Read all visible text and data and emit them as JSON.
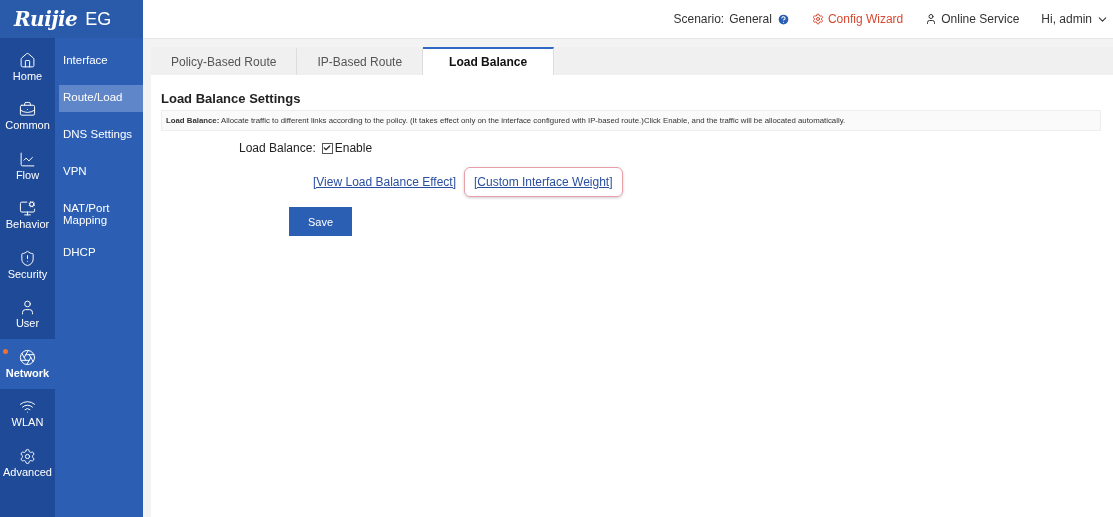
{
  "logo": {
    "brand": "Ruijie",
    "product": "EG"
  },
  "header": {
    "scenario_label": "Scenario:",
    "scenario_value": "General",
    "config_wizard": "Config Wizard",
    "online_service": "Online Service",
    "user_menu": "Hi, admin"
  },
  "nav": [
    {
      "label": "Home",
      "selected": false,
      "alert": false
    },
    {
      "label": "Common",
      "selected": false,
      "alert": false
    },
    {
      "label": "Flow",
      "selected": false,
      "alert": false
    },
    {
      "label": "Behavior",
      "selected": false,
      "alert": false
    },
    {
      "label": "Security",
      "selected": false,
      "alert": false
    },
    {
      "label": "User",
      "selected": false,
      "alert": false
    },
    {
      "label": "Network",
      "selected": true,
      "alert": true
    },
    {
      "label": "WLAN",
      "selected": false,
      "alert": false
    },
    {
      "label": "Advanced",
      "selected": false,
      "alert": false
    }
  ],
  "submenu": [
    {
      "label": "Interface",
      "selected": false
    },
    {
      "label": "Route/Load",
      "selected": true
    },
    {
      "label": "DNS Settings",
      "selected": false
    },
    {
      "label": "VPN",
      "selected": false
    },
    {
      "label": "NAT/Port Mapping",
      "selected": false
    },
    {
      "label": "DHCP",
      "selected": false
    }
  ],
  "tabs": [
    {
      "label": "Policy-Based Route",
      "selected": false
    },
    {
      "label": "IP-Based Route",
      "selected": false
    },
    {
      "label": "Load Balance",
      "selected": true
    }
  ],
  "section_title": "Load Balance Settings",
  "description": "**Load Balance:** Allocate traffic to different links according to the policy. (It takes effect only on the interface configured with IP-based route.)Click Enable, and the traffic will be allocated automatically.",
  "form": {
    "label": "Load Balance:",
    "checkbox": {
      "label": "Enable",
      "checked": true
    }
  },
  "links": [
    {
      "label": "[View Load Balance Effect]",
      "highlighted": false
    },
    {
      "label": "[Custom Interface Weight]",
      "highlighted": true
    }
  ],
  "save_button": "Save"
}
